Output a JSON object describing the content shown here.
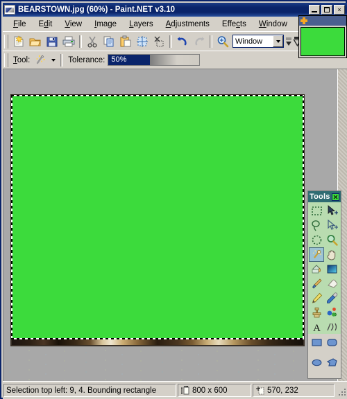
{
  "window": {
    "title": "BEARSTOWN.jpg (60%) - Paint.NET v3.10",
    "app_icon": "paintnet-icon",
    "minimize_label": "",
    "maximize_label": "",
    "close_label": "×"
  },
  "menubar": {
    "items": [
      {
        "label": "File",
        "mnemonic": "F"
      },
      {
        "label": "Edit",
        "mnemonic": "E"
      },
      {
        "label": "View",
        "mnemonic": "V"
      },
      {
        "label": "Image",
        "mnemonic": "I"
      },
      {
        "label": "Layers",
        "mnemonic": "L"
      },
      {
        "label": "Adjustments",
        "mnemonic": "A"
      },
      {
        "label": "Effects",
        "mnemonic": "c"
      },
      {
        "label": "Window",
        "mnemonic": "W"
      }
    ]
  },
  "toolbar": {
    "buttons": [
      {
        "name": "new-icon",
        "title": "New"
      },
      {
        "name": "open-icon",
        "title": "Open"
      },
      {
        "name": "save-icon",
        "title": "Save"
      },
      {
        "name": "print-icon",
        "title": "Print"
      },
      {
        "name": "cut-icon",
        "title": "Cut"
      },
      {
        "name": "copy-icon",
        "title": "Copy"
      },
      {
        "name": "paste-icon",
        "title": "Paste"
      },
      {
        "name": "crop-to-selection-icon",
        "title": "Crop to Selection"
      },
      {
        "name": "deselect-all-icon",
        "title": "Deselect All"
      },
      {
        "name": "undo-icon",
        "title": "Undo"
      },
      {
        "name": "redo-icon",
        "title": "Redo"
      },
      {
        "name": "zoom-icon",
        "title": "Zoom"
      }
    ],
    "zoom_value": "Window",
    "overflow_label": ""
  },
  "tool_options": {
    "tool_label": "Tool:",
    "tool_mnemonic": "T",
    "active_tool_icon": "magic-wand-icon",
    "tolerance_label": "Tolerance:",
    "tolerance_value": "50%",
    "tolerance_percent": 45
  },
  "canvas": {
    "fill_color": "#3cdb3c",
    "background_color": "#a8a8a8",
    "shadow_color": "#3a3128",
    "selection_style": "marching-ants"
  },
  "tools_palette": {
    "title": "Tools",
    "close_label": "×",
    "selected_tool": "magic-wand-icon",
    "rows": [
      [
        "rectangle-select-icon",
        "move-selected-icon"
      ],
      [
        "lasso-select-icon",
        "move-selection-icon"
      ],
      [
        "ellipse-select-icon",
        "zoom-tool-icon"
      ],
      [
        "magic-wand-icon",
        "pan-icon"
      ],
      [
        "paint-bucket-icon",
        "gradient-icon"
      ],
      [
        "paintbrush-icon",
        "eraser-icon"
      ],
      [
        "pencil-icon",
        "color-picker-icon"
      ],
      [
        "clone-stamp-icon",
        "recolor-icon"
      ],
      [
        "text-icon",
        "line-curve-icon"
      ]
    ],
    "shape_rows": [
      [
        "rectangle-shape-icon",
        "rounded-rectangle-shape-icon"
      ],
      [
        "ellipse-shape-icon",
        "freeform-shape-icon"
      ]
    ]
  },
  "thumbnail_window": {
    "icon": "star-icon",
    "preview_color": "#3cdb3c"
  },
  "statusbar": {
    "selection_info": "Selection top left: 9, 4. Bounding rectangle",
    "image_size_icon": "image-size-icon",
    "image_size": "800 x 600",
    "cursor_pos_icon": "cursor-position-icon",
    "cursor_position": "570, 232"
  }
}
